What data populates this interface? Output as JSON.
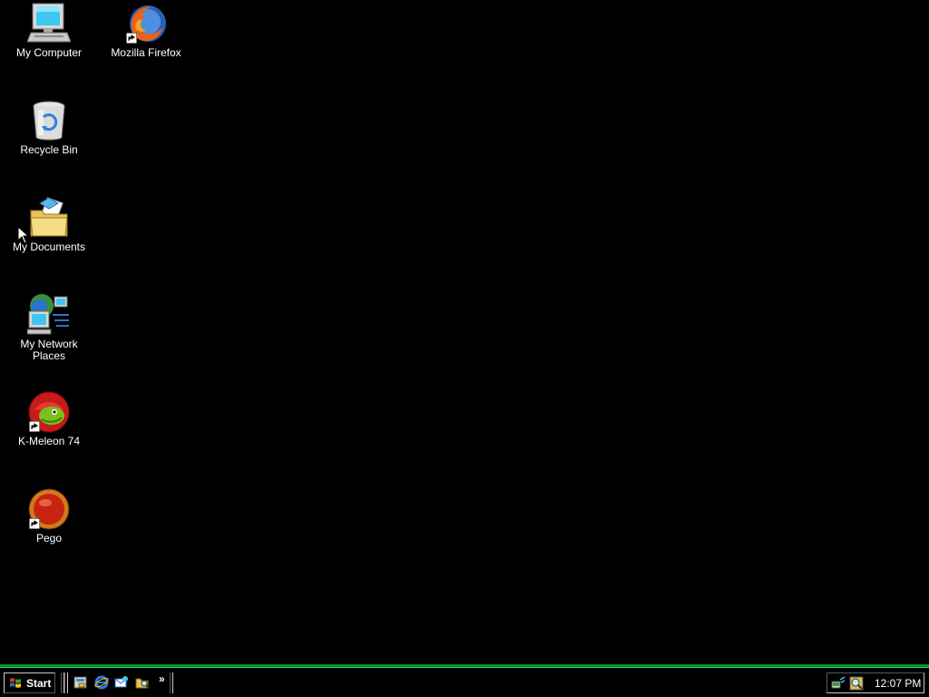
{
  "desktop": {
    "background_color": "#000000",
    "icons": [
      {
        "label": "My Computer",
        "icon": "my-computer-icon",
        "shortcut": false
      },
      {
        "label": "Mozilla Firefox",
        "icon": "firefox-icon",
        "shortcut": true
      },
      {
        "label": "Recycle Bin",
        "icon": "recycle-bin-icon",
        "shortcut": false
      },
      {
        "label": "My Documents",
        "icon": "my-documents-icon",
        "shortcut": false
      },
      {
        "label": "My Network Places",
        "icon": "network-places-icon",
        "shortcut": false
      },
      {
        "label": "K-Meleon 74",
        "icon": "k-meleon-icon",
        "shortcut": true
      },
      {
        "label": "Pego",
        "icon": "pego-icon",
        "shortcut": true
      }
    ]
  },
  "taskbar": {
    "accent_color": "#0b8f2c",
    "start_label": "Start",
    "quick_launch": [
      {
        "icon": "show-desktop-icon"
      },
      {
        "icon": "internet-explorer-icon"
      },
      {
        "icon": "outlook-express-icon"
      },
      {
        "icon": "windows-explorer-icon"
      }
    ],
    "quick_launch_more": "»",
    "tray": {
      "icons": [
        {
          "icon": "network-tray-icon"
        },
        {
          "icon": "security-tray-icon"
        }
      ],
      "clock": "12:07 PM"
    }
  }
}
